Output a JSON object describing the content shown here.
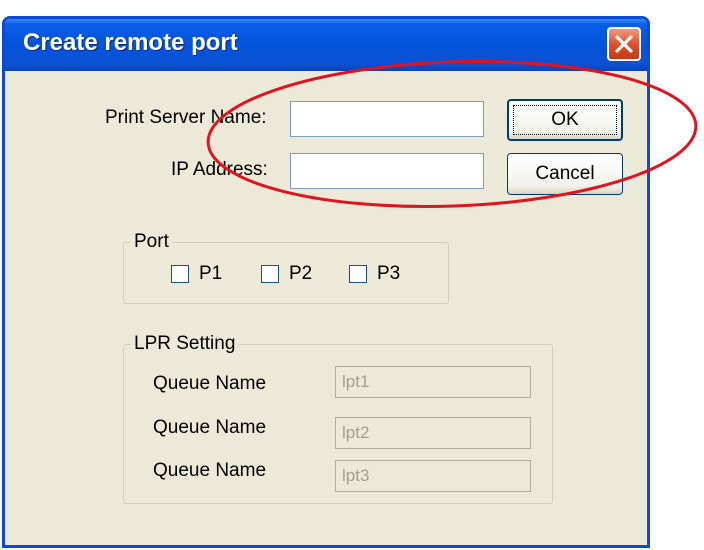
{
  "window": {
    "title": "Create remote port"
  },
  "form": {
    "print_server_label": "Print Server Name:",
    "print_server_value": "",
    "ip_label": "IP Address:",
    "ip_value": ""
  },
  "buttons": {
    "ok_label": "OK",
    "cancel_label": "Cancel"
  },
  "port_group": {
    "legend": "Port",
    "items": [
      {
        "label": "P1",
        "checked": false
      },
      {
        "label": "P2",
        "checked": false
      },
      {
        "label": "P3",
        "checked": false
      }
    ]
  },
  "lpr_group": {
    "legend": "LPR Setting",
    "rows": [
      {
        "label": "Queue Name",
        "value": "lpt1"
      },
      {
        "label": "Queue Name",
        "value": "lpt2"
      },
      {
        "label": "Queue Name",
        "value": "lpt3"
      }
    ]
  },
  "colors": {
    "annotation": "#e0141e",
    "titlebar": "#0453db",
    "dialog_bg": "#ece9d8"
  }
}
